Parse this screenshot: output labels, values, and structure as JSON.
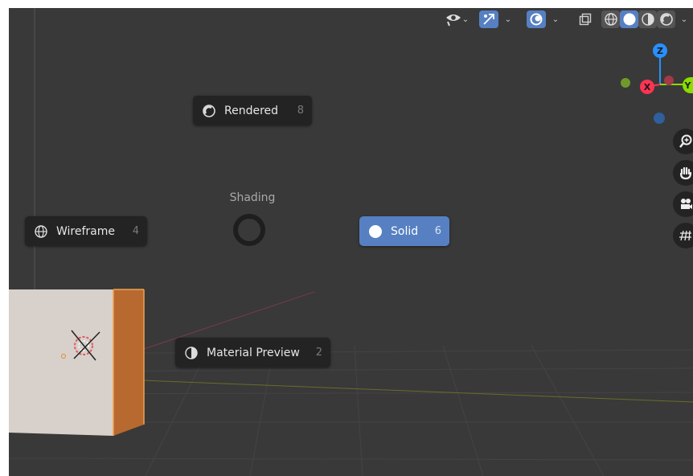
{
  "header": {
    "view_toggle_icon": "visibility-icon",
    "gizmo_toggle_icon": "gizmo-icon",
    "overlay_toggle_icon": "overlay-icon",
    "xray_toggle_icon": "xray-icon",
    "shading_modes": [
      "wireframe-icon",
      "solid-icon",
      "material-icon",
      "rendered-icon"
    ],
    "active_shading": "solid"
  },
  "pie_menu": {
    "title": "Shading",
    "items": {
      "rendered": {
        "label": "Rendered",
        "key": "8",
        "icon": "rendered-icon"
      },
      "wireframe": {
        "label": "Wireframe",
        "key": "4",
        "icon": "wireframe-icon"
      },
      "solid": {
        "label": "Solid",
        "key": "6",
        "icon": "solid-icon",
        "active": true
      },
      "material": {
        "label": "Material Preview",
        "key": "2",
        "icon": "material-icon"
      }
    }
  },
  "gizmo": {
    "z": "Z",
    "x": "X",
    "y": "Y",
    "colors": {
      "x": "#ff3352",
      "y": "#8bdc00",
      "z": "#2890ff"
    }
  },
  "nav_buttons": [
    "zoom-icon",
    "pan-icon",
    "camera-icon",
    "orthographic-grid-icon"
  ],
  "colors": {
    "active_blue": "#5680c2",
    "cube_face": "#d7d0cb",
    "cube_side": "#b8692f"
  }
}
